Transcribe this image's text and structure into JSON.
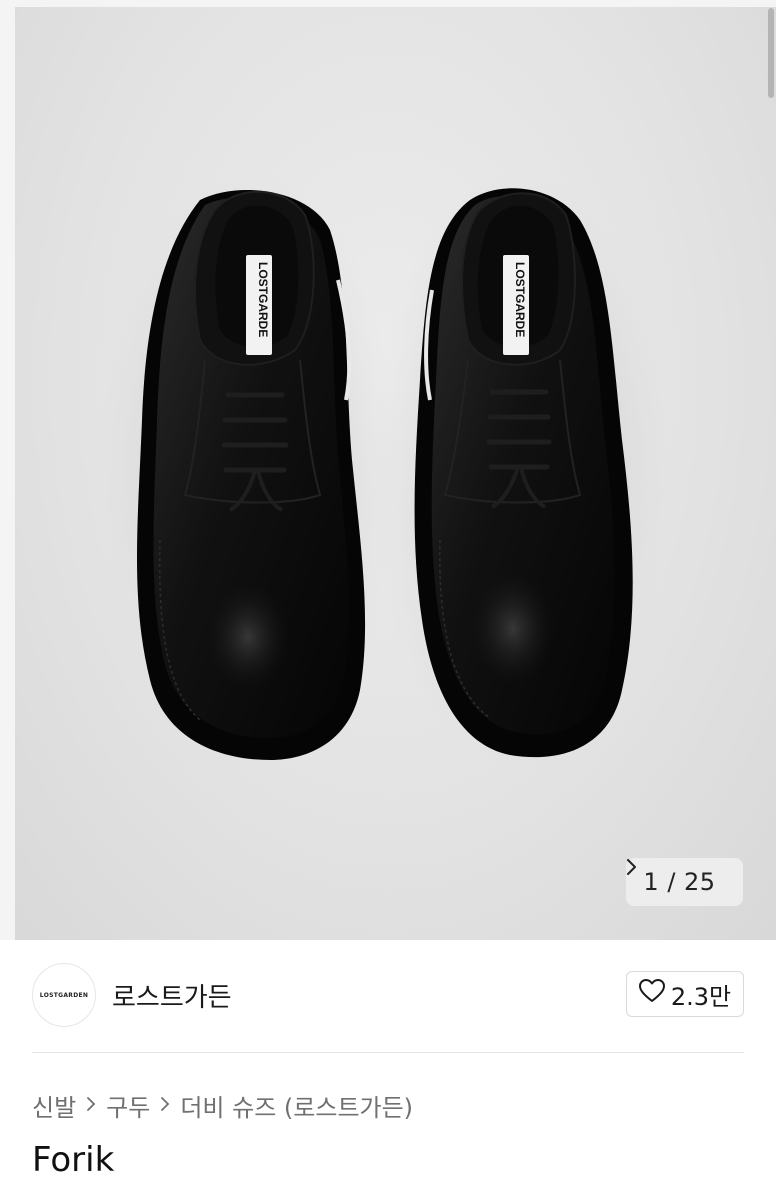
{
  "gallery": {
    "current": "1",
    "total": "25",
    "counter_text": "1 / 25",
    "tongue_label": "LOSTGARDE",
    "tongue_label_right": "LOSTGARDE"
  },
  "brand": {
    "logo_text": "LOSTGARDEN",
    "name": "로스트가든",
    "likes": "2.3만"
  },
  "breadcrumb": [
    "신발",
    "구두",
    "더비 슈즈 (로스트가든)"
  ],
  "product": {
    "title": "Forik"
  },
  "colors": {
    "shoe": "#0d0d0d",
    "background": "#e4e4e4"
  },
  "icons": [
    "chevron-right-icon",
    "heart-icon",
    "breadcrumb-chevron-icon"
  ]
}
